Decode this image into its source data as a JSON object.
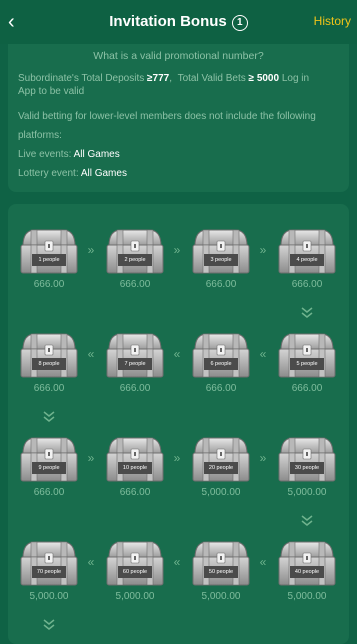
{
  "header": {
    "title": "Invitation Bonus",
    "badge": "1",
    "history_label": "History"
  },
  "rules": {
    "question": "What is a valid promotional number?",
    "deposit_label": "Subordinate's Total Deposits",
    "ge": "≥",
    "deposit_value": "777",
    "separator": ",",
    "bets_label": "Total Valid Bets",
    "bets_value": "5000",
    "login_text": "Log in",
    "line2": "App to be valid",
    "line3": "Valid betting for lower-level members does not include the following",
    "line4": "platforms:",
    "live_label": "Live events:",
    "live_value": "All Games",
    "lottery_label": "Lottery event:",
    "lottery_value": "All Games"
  },
  "chests": [
    {
      "label": "1 people",
      "amount": "666.00"
    },
    {
      "label": "2 people",
      "amount": "666.00"
    },
    {
      "label": "3 people",
      "amount": "666.00"
    },
    {
      "label": "4 people",
      "amount": "666.00"
    },
    {
      "label": "5 people",
      "amount": "666.00"
    },
    {
      "label": "8 people",
      "amount": "666.00"
    },
    {
      "label": "7 people",
      "amount": "666.00"
    },
    {
      "label": "6 people",
      "amount": "666.00"
    },
    {
      "label": "9 people",
      "amount": "666.00"
    },
    {
      "label": "10 people",
      "amount": "666.00"
    },
    {
      "label": "20 people",
      "amount": "5,000.00"
    },
    {
      "label": "30 people",
      "amount": "5,000.00"
    },
    {
      "label": "40 people",
      "amount": "5,000.00"
    },
    {
      "label": "50 people",
      "amount": "5,000.00"
    },
    {
      "label": "60 people",
      "amount": "5,000.00"
    },
    {
      "label": "70 people",
      "amount": "5,000.00"
    }
  ],
  "icons": {
    "arrow_right": "»",
    "arrow_left": "«",
    "back": "‹"
  },
  "colors": {
    "background": "#0f6245",
    "panel": "#186d4d",
    "accent_history": "#f0c419"
  }
}
